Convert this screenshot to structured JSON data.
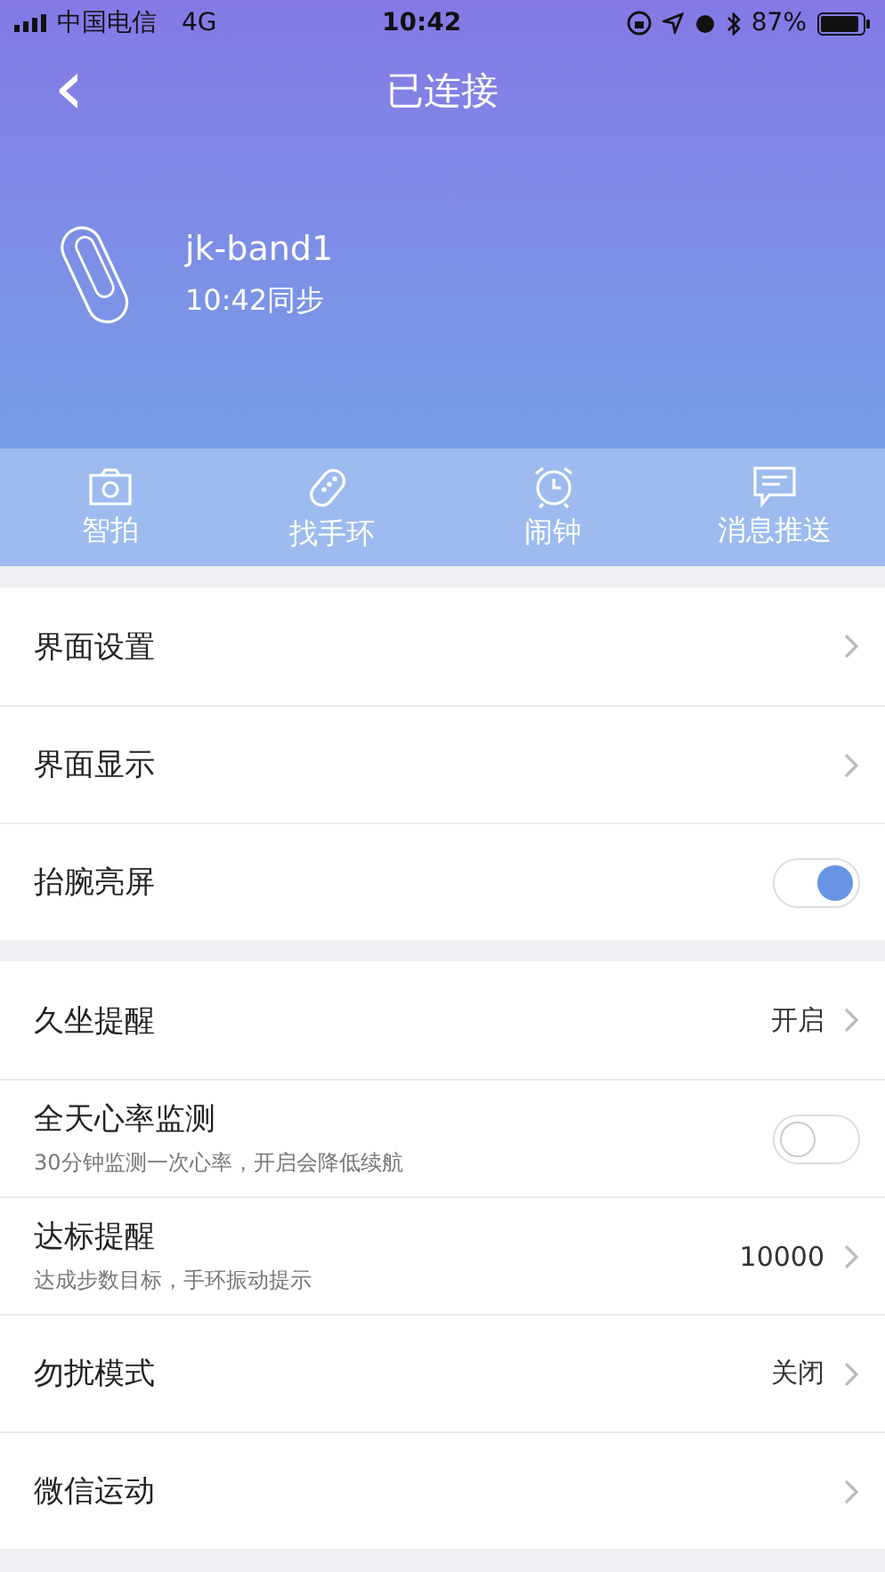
{
  "status_bar": {
    "carrier": "中国电信",
    "network": "4G",
    "time": "10:42",
    "battery": "87%"
  },
  "nav": {
    "back": "‹",
    "title": "已连接"
  },
  "device": {
    "name": "jk-band1",
    "sync": "10:42同步"
  },
  "shortcuts": [
    {
      "kind": "camera",
      "label": "智拍"
    },
    {
      "kind": "band",
      "label": "找手环"
    },
    {
      "kind": "alarm",
      "label": "闹钟"
    },
    {
      "kind": "message",
      "label": "消息推送"
    }
  ],
  "groups": [
    {
      "rows": [
        {
          "kind": "link",
          "label": "界面设置"
        },
        {
          "kind": "link",
          "label": "界面显示"
        },
        {
          "kind": "toggle",
          "label": "抬腕亮屏",
          "on": true
        }
      ]
    },
    {
      "rows": [
        {
          "kind": "link",
          "label": "久坐提醒",
          "value": "开启"
        },
        {
          "kind": "toggle",
          "label": "全天心率监测",
          "subtitle": "30分钟监测一次心率，开启会降低续航",
          "on": false
        },
        {
          "kind": "link",
          "label": "达标提醒",
          "subtitle": "达成步数目标，手环振动提示",
          "value": "10000"
        },
        {
          "kind": "link",
          "label": "勿扰模式",
          "value": "关闭"
        },
        {
          "kind": "link",
          "label": "微信运动"
        }
      ]
    }
  ]
}
